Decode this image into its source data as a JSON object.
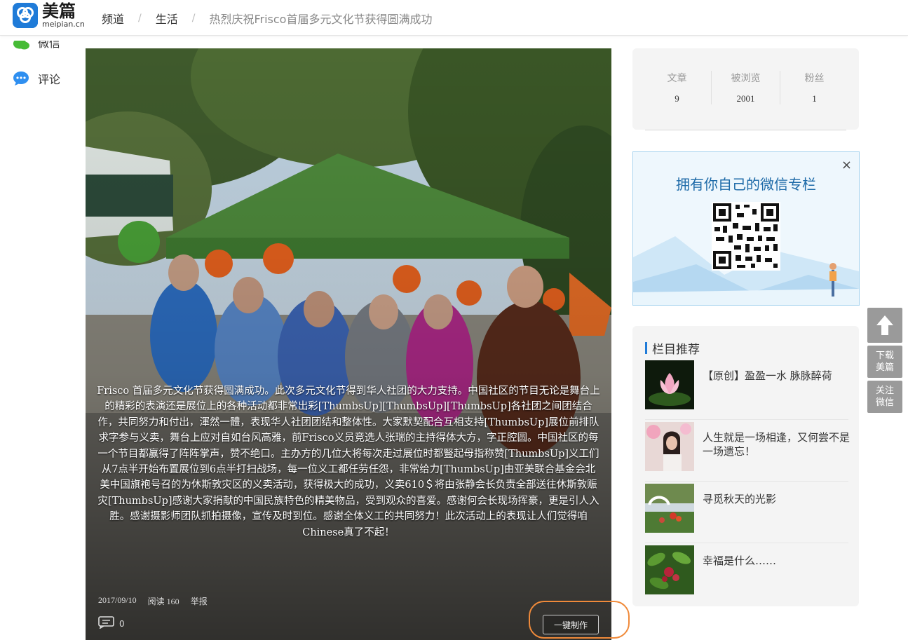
{
  "header": {
    "logo_cn": "美篇",
    "logo_en": "meipian.cn",
    "breadcrumb": [
      "频道",
      "生活",
      "热烈庆祝Frisco首届多元文化节获得圆满成功"
    ]
  },
  "share": [
    {
      "label": "微信",
      "icon": "wechat-icon"
    },
    {
      "label": "评论",
      "icon": "comment-icon"
    }
  ],
  "article": {
    "caption": "Frisco 首届多元文化节获得圆满成功。此次多元文化节得到华人社团的大力支持。中国社区的节目无论是舞台上的精彩的表演还是展位上的各种活动都非常出彩[ThumbsUp][ThumbsUp][ThumbsUp]各社团之间团结合作，共同努力和付出，渾然一體，表现华人社团团结和整体性。大家默契配合互相支持[ThumbsUp]展位前排队求字参与义卖，舞台上应对自如台风高雅，前Frisco义员竞选人张瑞的主持得体大方，字正腔圆。中国社区的每一个节目都赢得了阵阵掌声，赞不绝口。主办方的几位大将每次走过展位时都豎起母指称赞[ThumbsUp]义工们从7点半开始布置展位到6点半打扫战场，每一位义工都任劳任怨，非常给力[ThumbsUp]由亚美联合基金会北美中国旗袍号召的为休斯敦灾区的义卖活动，获得极大的成功，义卖610＄将由张静会长负责全部送往休斯敦赈灾[ThumbsUp]感谢大家捐献的中国民族特色的精美物品，受到观众的喜爱。感谢何会长现场挥豪，更是引人入胜。感谢摄影师团队抓拍摄像，宣传及时到位。感谢全体义工的共同努力！此次活动上的表现让人们觉得咱Chinese真了不起！",
    "date": "2017/09/10",
    "reads": "阅读 160",
    "report": "举报",
    "comment_count": "0",
    "make_button": "一键制作"
  },
  "stats": [
    {
      "label": "文章",
      "value": "9"
    },
    {
      "label": "被浏览",
      "value": "2001"
    },
    {
      "label": "粉丝",
      "value": "1"
    }
  ],
  "ad": {
    "title": "拥有你自己的微信专栏",
    "close": "×"
  },
  "side_buttons": {
    "top_icon": "arrow-up-icon",
    "download": [
      "下载",
      "美篇"
    ],
    "follow": [
      "关注",
      "微信"
    ]
  },
  "recommend": {
    "title": "栏目推荐",
    "items": [
      {
        "title": "【原创】盈盈一水 脉脉醉荷"
      },
      {
        "title": "人生就是一场相逢，又何尝不是一场遗忘！"
      },
      {
        "title": "寻觅秋天的光影"
      },
      {
        "title": "幸福是什么……"
      }
    ]
  },
  "colors": {
    "brand": "#1f7bd8",
    "annotation_circle": "#f08a3a",
    "side_button": "#9a9a9a"
  }
}
